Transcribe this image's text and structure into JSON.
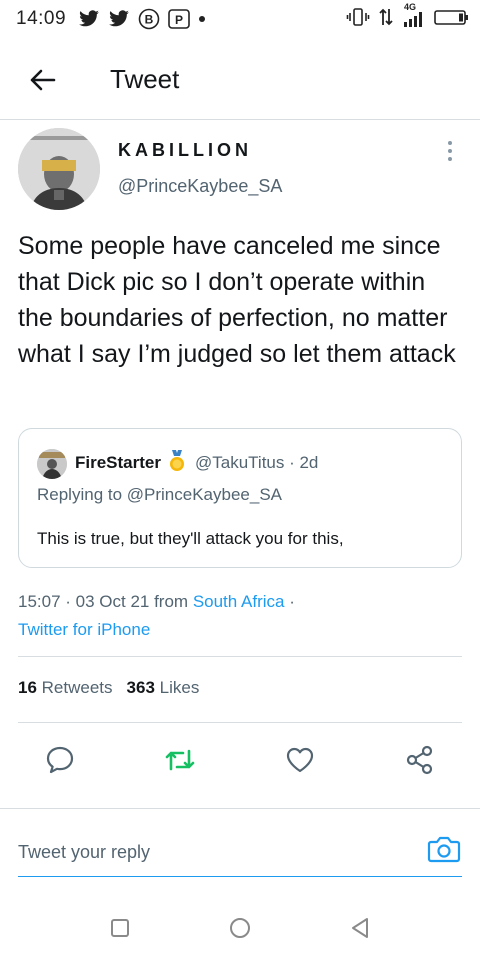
{
  "status_bar": {
    "time": "14:09",
    "network": "4G"
  },
  "header": {
    "title": "Tweet"
  },
  "author": {
    "name": "KABILLION",
    "handle": "@PrinceKaybee_SA"
  },
  "tweet": {
    "text": "Some people have canceled me since that Dick pic so I don’t operate within the boundaries of perfection, no matter what I say I’m judged so let them attack"
  },
  "quoted": {
    "name": "FireStarter",
    "handle_time": "@TakuTitus · 2d",
    "replying_to": "Replying to @PrinceKaybee_SA",
    "text": "This is true, but they'll attack you for this,"
  },
  "meta": {
    "time_date": "15:07 · 03 Oct 21 from ",
    "location": "South Africa",
    "location_suffix": " ·",
    "client": "Twitter for iPhone"
  },
  "stats": {
    "retweets_count": "16",
    "retweets_label": "Retweets",
    "likes_count": "363",
    "likes_label": "Likes"
  },
  "actions": {
    "reply_icon": "speech-bubble-icon",
    "retweet_icon": "retweet-icon",
    "like_icon": "heart-icon",
    "share_icon": "share-icon",
    "retweet_color": "#17bf63"
  },
  "reply": {
    "placeholder": "Tweet your reply"
  },
  "colors": {
    "accent": "#1d9bf0",
    "secondary_text": "#536471"
  }
}
